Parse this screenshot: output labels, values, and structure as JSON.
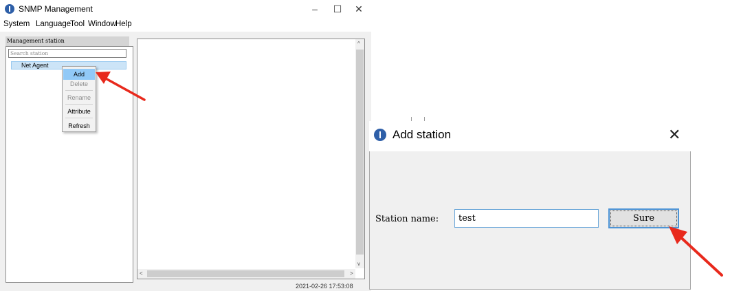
{
  "window": {
    "title": "SNMP Management",
    "controls": {
      "minimize": "–",
      "maximize": "☐",
      "close": "✕"
    },
    "menu": [
      "System",
      "Language",
      "Tool",
      "Window",
      "Help"
    ]
  },
  "left_panel": {
    "header": "Management station",
    "search_placeholder": "Search station",
    "tree": [
      {
        "label": "Net Agent",
        "selected": true
      }
    ]
  },
  "context_menu": {
    "items": [
      {
        "label": "Add",
        "enabled": true,
        "highlighted": true
      },
      {
        "label": "Delete",
        "enabled": false
      },
      {
        "label": "Rename",
        "enabled": false
      },
      {
        "label": "Attribute",
        "enabled": true
      },
      {
        "label": "Refresh",
        "enabled": true
      }
    ]
  },
  "scroll_arrows": {
    "up": "^",
    "down": "v",
    "left": "<",
    "right": ">"
  },
  "status_bar": {
    "timestamp": "2021-02-26 17:53:08"
  },
  "dialog": {
    "title": "Add station",
    "close": "✕",
    "field_label": "Station name:",
    "field_value": "test",
    "button": "Sure"
  },
  "colors": {
    "accent": "#2e5fa8",
    "selection": "#cce4f7",
    "menu_highlight": "#91c9f7",
    "annotation_arrow": "#e8291c"
  },
  "icons": [
    "app-icon",
    "close-icon",
    "minimize-icon",
    "maximize-icon"
  ]
}
